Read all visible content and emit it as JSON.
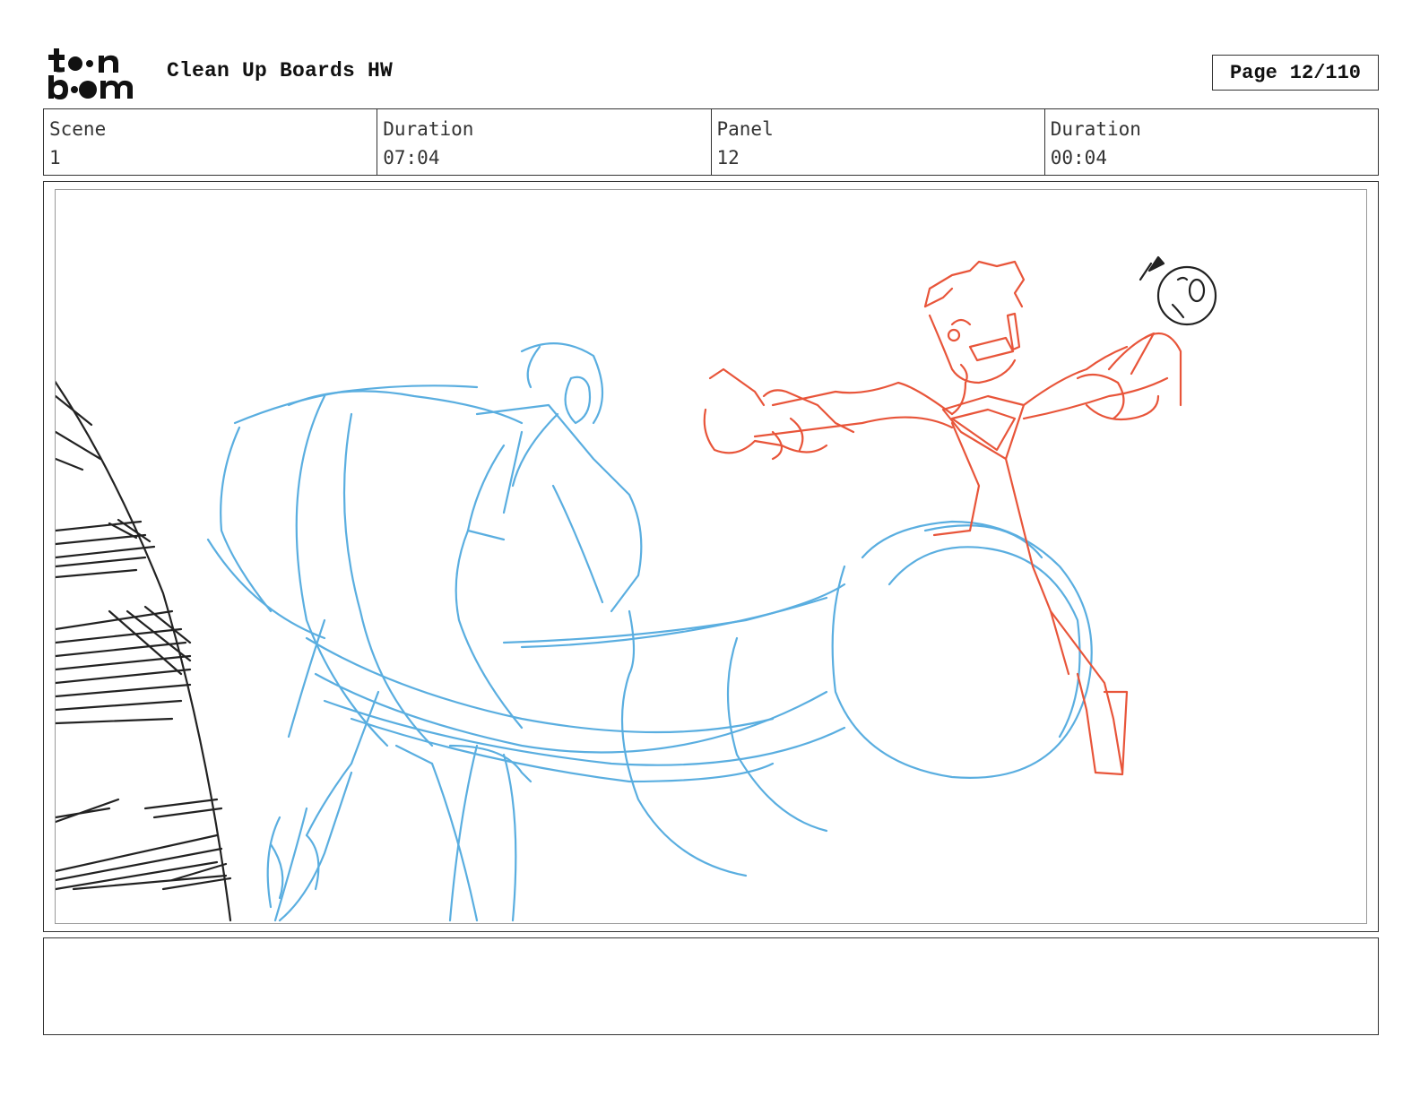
{
  "header": {
    "logo_text": "toon boom",
    "title": "Clean Up Boards HW",
    "page_label": "Page",
    "page_number": "12/110"
  },
  "info": {
    "scene_label": "Scene",
    "scene_value": "1",
    "scene_duration_label": "Duration",
    "scene_duration_value": "07:04",
    "panel_label": "Panel",
    "panel_value": "12",
    "panel_duration_label": "Duration",
    "panel_duration_value": "00:04"
  },
  "colors": {
    "blue_sketch": "#5aaee0",
    "red_sketch": "#e8553a",
    "ink": "#222222"
  },
  "notes": {
    "text": ""
  }
}
